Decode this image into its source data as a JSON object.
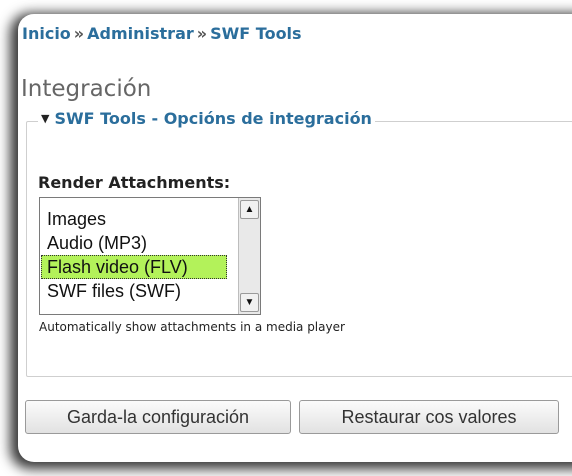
{
  "breadcrumb": {
    "items": [
      "Inicio",
      "Administrar",
      "SWF Tools"
    ],
    "separator": "»"
  },
  "page": {
    "title": "Integración"
  },
  "fieldset": {
    "legend": "SWF Tools - Opcións de integración",
    "collapse_icon": "triangle-down-icon"
  },
  "render_attachments": {
    "label": "Render Attachments:",
    "options": [
      "Images",
      "Audio (MP3)",
      "Flash video (FLV)",
      "SWF files (SWF)"
    ],
    "selected": "Flash video (FLV)",
    "help": "Automatically show attachments in a media player"
  },
  "buttons": {
    "save": "Garda-la configuración",
    "reset": "Restaurar cos valores"
  },
  "colors": {
    "link": "#2b6e9c",
    "selected_option": "#b3f25a"
  }
}
